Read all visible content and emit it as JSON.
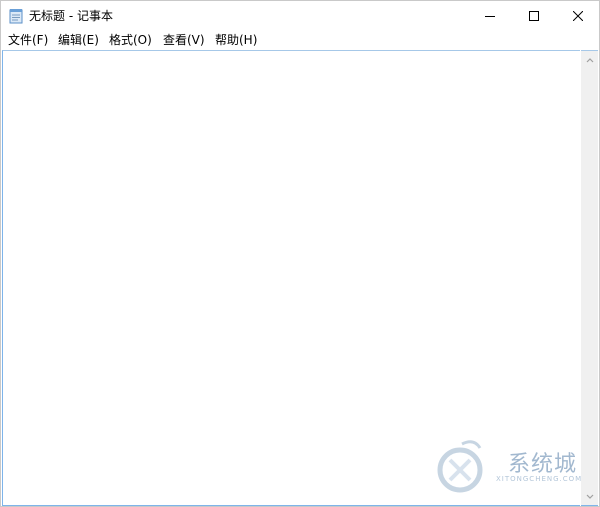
{
  "window": {
    "title": "无标题 - 记事本",
    "icon": "notepad-icon"
  },
  "caption_buttons": {
    "minimize_icon": "minimize-icon",
    "maximize_icon": "maximize-icon",
    "close_icon": "close-icon"
  },
  "menu": {
    "items": [
      {
        "label": "文件(F)"
      },
      {
        "label": "编辑(E)"
      },
      {
        "label": "格式(O)"
      },
      {
        "label": "查看(V)"
      },
      {
        "label": "帮助(H)"
      }
    ]
  },
  "editor": {
    "text": ""
  },
  "watermark": {
    "text": "系统城",
    "subtext": "XITONGCHENG.COM"
  },
  "colors": {
    "border": "#c9c9c9",
    "editor_border": "#7eb4ea",
    "scrollbar": "#f0f0f0"
  }
}
